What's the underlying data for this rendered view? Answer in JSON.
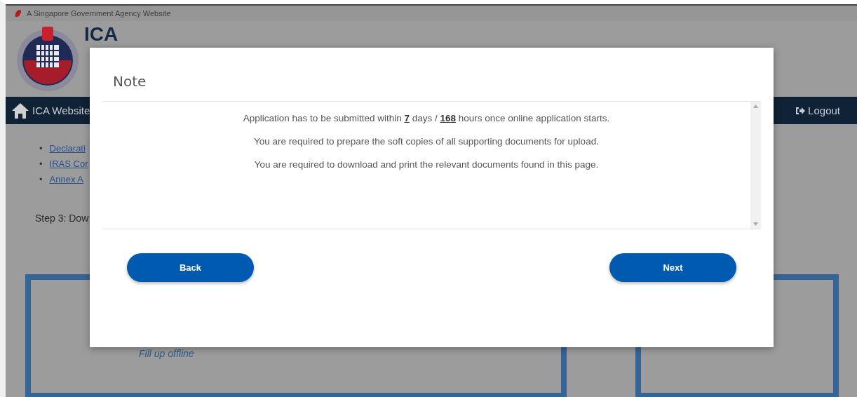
{
  "gov_banner": {
    "text": "A Singapore Government Agency Website"
  },
  "header": {
    "logo_text": "ICA"
  },
  "nav": {
    "home_link": "ICA Website",
    "logout": "Logout"
  },
  "links": [
    {
      "bullet": "•",
      "label": "Declarati"
    },
    {
      "bullet": "•",
      "label": "IRAS Cor"
    },
    {
      "bullet": "•",
      "label": "Annex A"
    }
  ],
  "step_heading": "Step 3: Dow",
  "option_card": {
    "subtitle": "Fill up offline"
  },
  "dialog": {
    "title": "Note",
    "lines": [
      "Application has to be submitted within **7** days / **168** hours once online application starts.",
      "You are required to prepare the soft copies of all supporting documents for upload.",
      "You are required to download and print the relevant documents found in this page."
    ],
    "buttons": [
      "Back",
      "Next"
    ]
  }
}
